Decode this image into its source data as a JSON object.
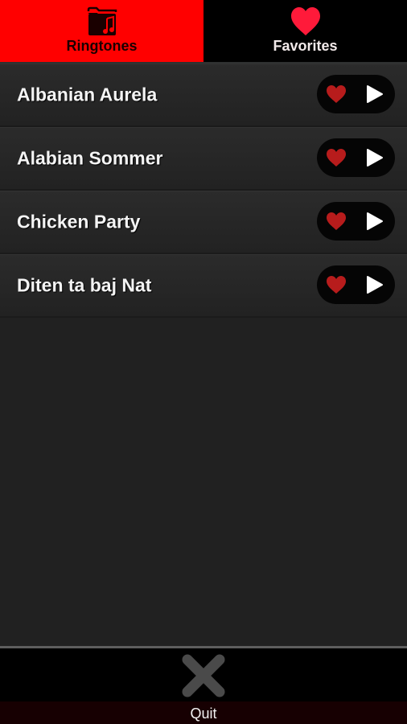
{
  "tabs": [
    {
      "label": "Ringtones",
      "icon": "folder-music-icon",
      "active": true
    },
    {
      "label": "Favorites",
      "icon": "heart-icon",
      "active": false
    }
  ],
  "ringtones": [
    {
      "title": "Albanian Aurela",
      "favorite_icon": "heart-icon",
      "play_icon": "play-icon"
    },
    {
      "title": "Alabian Sommer",
      "favorite_icon": "heart-icon",
      "play_icon": "play-icon"
    },
    {
      "title": "Chicken Party",
      "favorite_icon": "heart-icon",
      "play_icon": "play-icon"
    },
    {
      "title": "Diten ta baj Nat",
      "favorite_icon": "heart-icon",
      "play_icon": "play-icon"
    }
  ],
  "footer": {
    "quit_label": "Quit",
    "quit_icon": "close-x-icon"
  },
  "colors": {
    "active_tab": "#ff0000",
    "inactive_tab": "#000000",
    "favorites_heart": "#ff1a3a",
    "row_heart": "#b71c1c",
    "background": "#212121"
  }
}
